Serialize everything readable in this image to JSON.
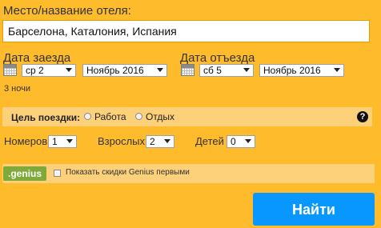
{
  "destination": {
    "label": "Место/название отеля:",
    "value": "Барселона, Каталония, Испания"
  },
  "checkin": {
    "label": "Дата заезда",
    "day": "ср 2",
    "month": "Ноябрь 2016"
  },
  "checkout": {
    "label": "Дата отъезда",
    "day": "сб 5",
    "month": "Ноябрь 2016"
  },
  "nights": "3 ночи",
  "purpose": {
    "label": "Цель поездки:",
    "options": [
      "Работа",
      "Отдых"
    ],
    "help": "?"
  },
  "occupancy": {
    "rooms_label": "Номеров",
    "rooms_value": "1",
    "adults_label": "Взрослых",
    "adults_value": "2",
    "children_label": "Детей",
    "children_value": "0"
  },
  "genius": {
    "logo": ".genius",
    "checkbox_label": "Показать скидки Genius первыми"
  },
  "search_button": "Найти",
  "colors": {
    "background": "#FEBB2C",
    "panel": "#FDD17A",
    "button": "#0896FF",
    "genius": "#7FAA3A"
  }
}
